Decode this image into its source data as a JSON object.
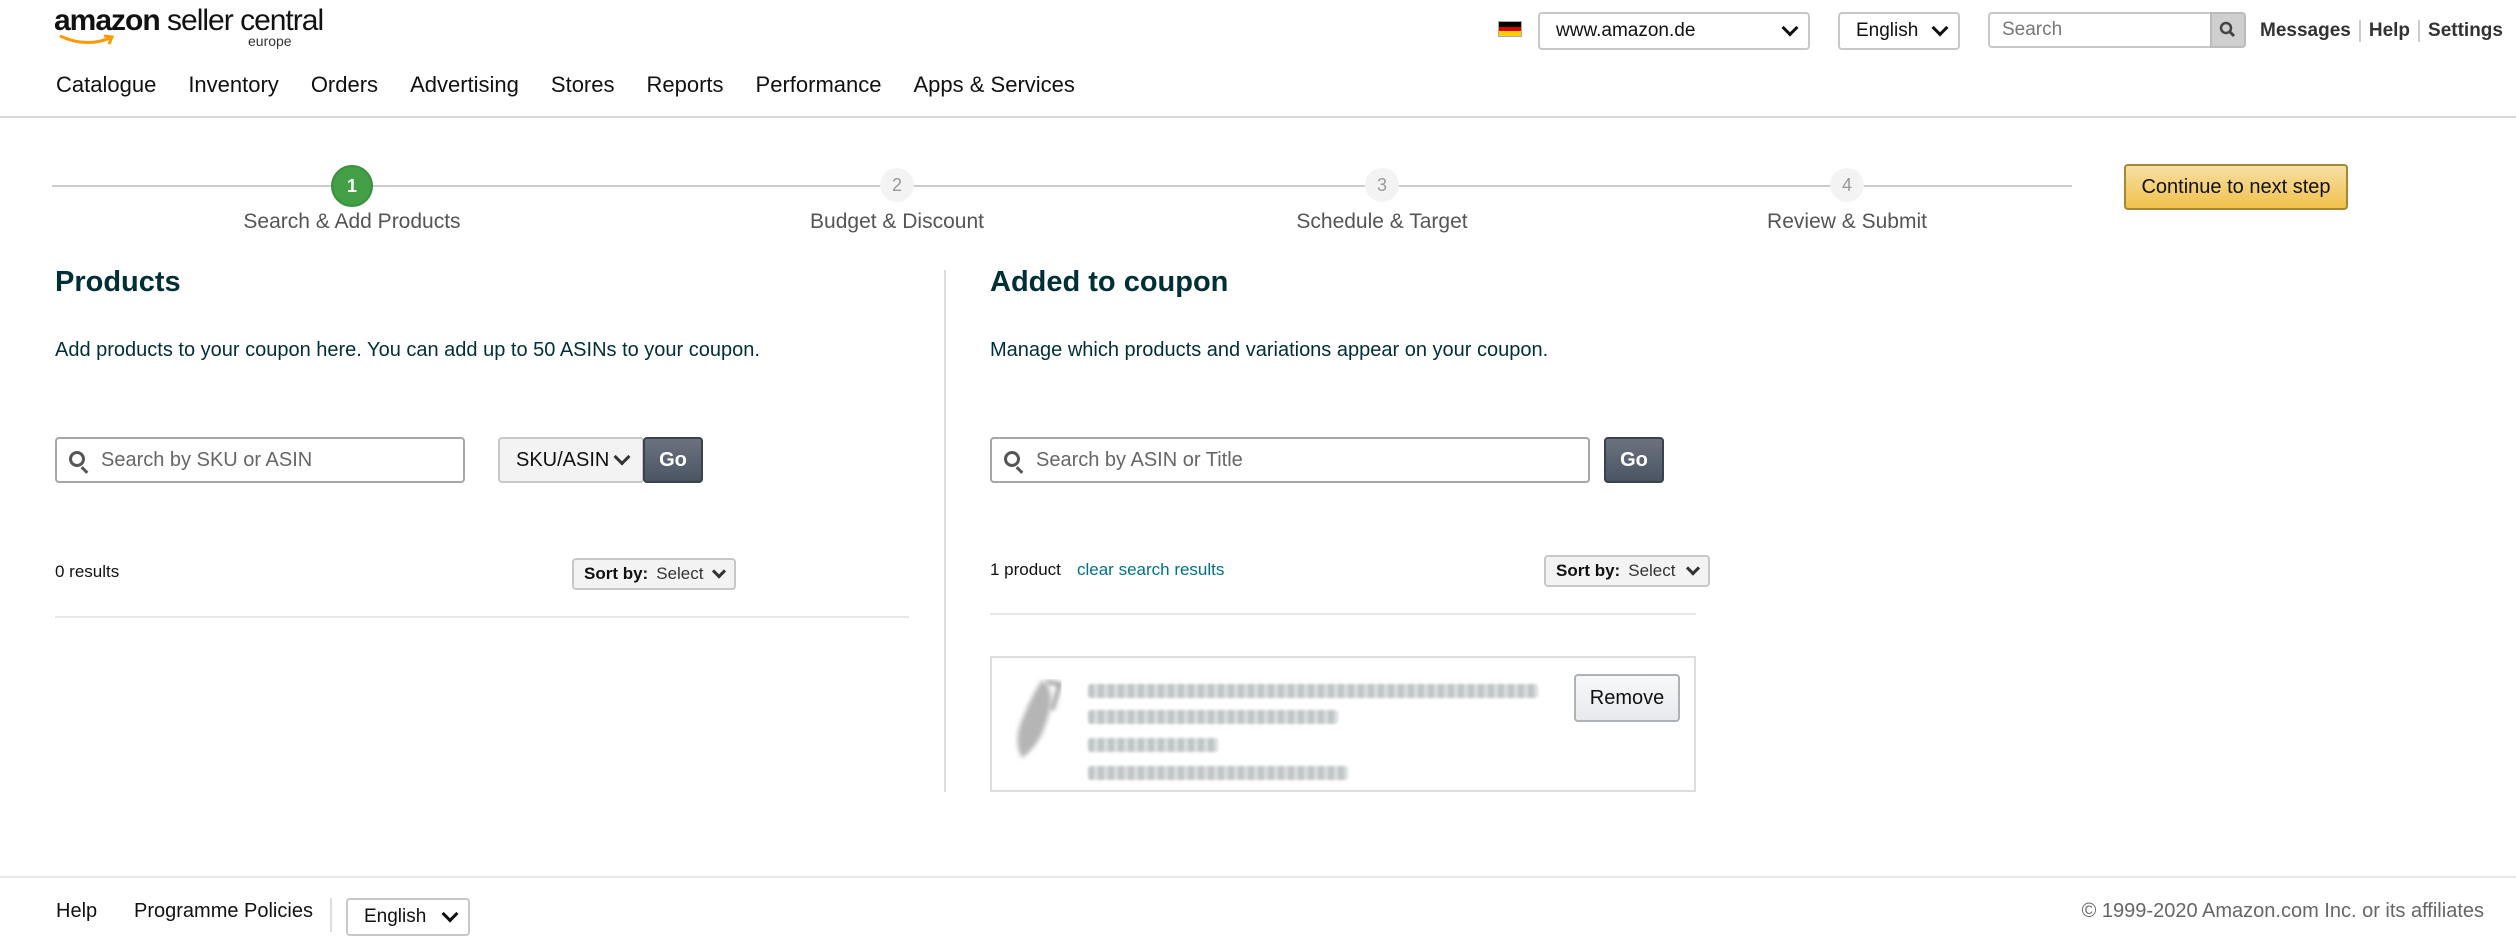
{
  "header": {
    "logo_brand_bold": "amazon",
    "logo_brand_rest": " seller central",
    "logo_region": "europe",
    "marketplace": "www.amazon.de",
    "language": "English",
    "search_placeholder": "Search",
    "links": [
      "Messages",
      "Help",
      "Settings"
    ]
  },
  "nav": [
    "Catalogue",
    "Inventory",
    "Orders",
    "Advertising",
    "Stores",
    "Reports",
    "Performance",
    "Apps & Services"
  ],
  "stepper": {
    "steps": [
      {
        "number": "1",
        "label": "Search & Add Products",
        "active": true
      },
      {
        "number": "2",
        "label": "Budget & Discount",
        "active": false
      },
      {
        "number": "3",
        "label": "Schedule & Target",
        "active": false
      },
      {
        "number": "4",
        "label": "Review & Submit",
        "active": false
      }
    ],
    "continue_label": "Continue to next step"
  },
  "products_panel": {
    "title": "Products",
    "description": "Add products to your coupon here. You can add up to 50 ASINs to your coupon.",
    "search_placeholder": "Search by SKU or ASIN",
    "search_type": "SKU/ASIN",
    "go_label": "Go",
    "results": "0 results",
    "sort_label": "Sort by:",
    "sort_value": "Select"
  },
  "coupon_panel": {
    "title": "Added to coupon",
    "description": "Manage which products and variations appear on your coupon.",
    "search_placeholder": "Search by ASIN or Title",
    "go_label": "Go",
    "results": "1 product",
    "clear_label": "clear search results",
    "sort_label": "Sort by:",
    "sort_value": "Select",
    "remove_label": "Remove"
  },
  "footer": {
    "help": "Help",
    "policies": "Programme Policies",
    "language": "English",
    "copyright": "© 1999-2020 Amazon.com Inc. or its affiliates"
  },
  "colors": {
    "step_active": "#43a047",
    "primary_button": "#f0c14b",
    "link": "#007185",
    "heading": "#002f36"
  }
}
